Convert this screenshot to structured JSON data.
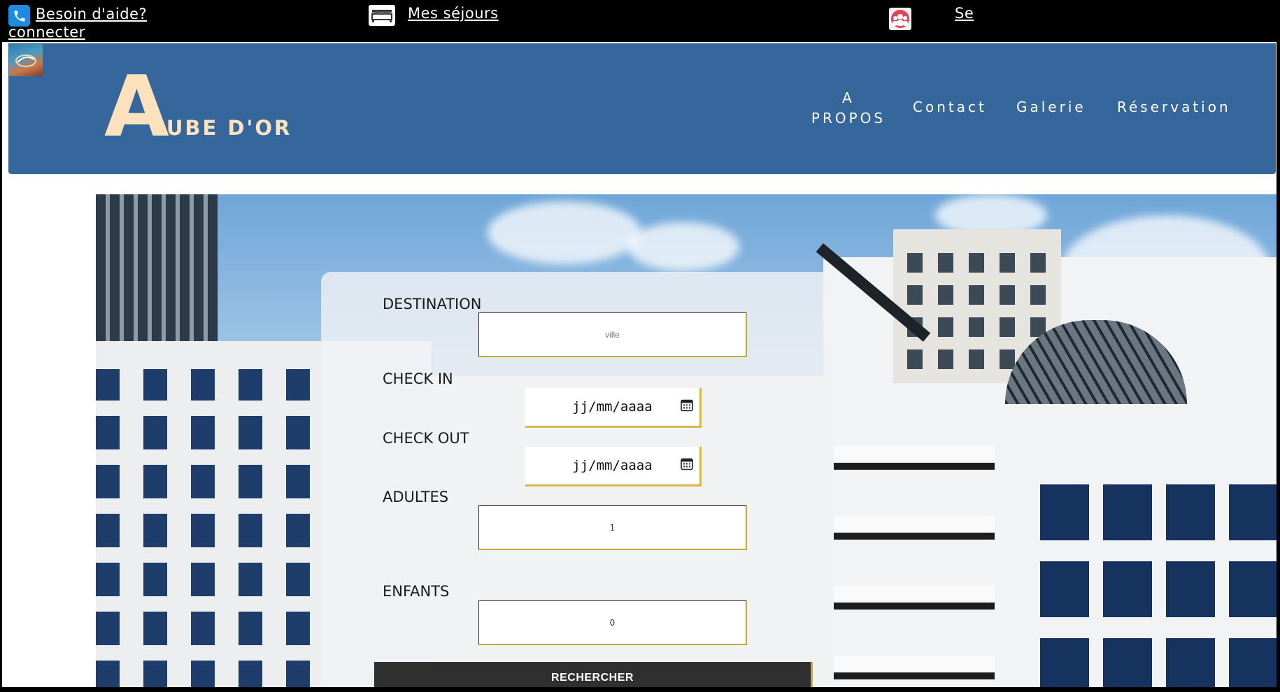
{
  "topbar": {
    "help_label": "Besoin d'aide?",
    "stays_label": "Mes séjours",
    "login_label_a": "Se",
    "login_label_b": "connecter"
  },
  "icons": {
    "phone": "phone-icon",
    "bed": "bed-icon",
    "login": "user-group-icon",
    "calendar": "calendar-icon"
  },
  "brand": {
    "initial": "A",
    "rest": "UBE D'OR"
  },
  "nav": {
    "apropos_line1": "A",
    "apropos_line2": "PROPOS",
    "contact": "Contact",
    "galerie": "Galerie",
    "reservation": "Réservation"
  },
  "search": {
    "destination_label": "DESTINATION",
    "destination_placeholder": "ville",
    "checkin_label": "CHECK IN",
    "checkin_placeholder": "jj/mm/aaaa",
    "checkout_label": "CHECK OUT",
    "checkout_placeholder": "jj/mm/aaaa",
    "adults_label": "ADULTES",
    "adults_value": "1",
    "children_label": "ENFANTS",
    "children_value": "0",
    "submit_label": "RECHERCHER"
  },
  "colors": {
    "header_bg": "#35679c",
    "brand_text": "#fde2bd",
    "accent_gold": "#c8a92f",
    "button_bg": "#2f2f2f"
  }
}
